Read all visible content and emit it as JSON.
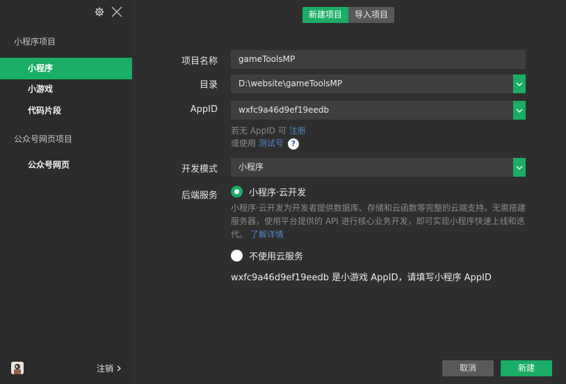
{
  "sidebar": {
    "groups": [
      "小程序项目",
      "公众号网页项目"
    ],
    "items": [
      "小程序",
      "小游戏",
      "代码片段",
      "公众号网页"
    ],
    "active_item": "小程序",
    "logout_label": "注销"
  },
  "tabs": {
    "new_label": "新建项目",
    "import_label": "导入项目"
  },
  "form": {
    "name_label": "项目名称",
    "name_value": "gameToolsMP",
    "dir_label": "目录",
    "dir_value": "D:\\website\\gameToolsMP",
    "appid_label": "AppID",
    "appid_value": "wxfc9a46d9ef19eedb",
    "appid_hint_prefix": "若无 AppID 可",
    "appid_hint_link": "注册",
    "test_hint_prefix": "或使用",
    "test_hint_link": "测试号",
    "help_icon": "?",
    "mode_label": "开发模式",
    "mode_value": "小程序",
    "backend_label": "后端服务",
    "cloud_option": "小程序·云开发",
    "cloud_desc": "小程序·云开发为开发者提供数据库、存储和云函数等完整的云端支持。无需搭建服务器，使用平台提供的 API 进行核心业务开发，即可实现小程序快速上线和迭代。",
    "cloud_desc_link": "了解详情",
    "no_cloud_option": "不使用云服务",
    "warning": "wxfc9a46d9ef19eedb 是小游戏 AppID，请填写小程序 AppID"
  },
  "footer": {
    "cancel_label": "取消",
    "create_label": "新建"
  },
  "icons": [
    "gear-icon",
    "close-icon",
    "chevron-down-icon",
    "chevron-right-icon",
    "help-icon"
  ],
  "colors": {
    "accent": "#1aad65",
    "sidebar_bg": "#2b2b2b",
    "main_bg": "#2e2e2e",
    "field_bg": "#3f3f3f",
    "link": "#4f86c6"
  }
}
